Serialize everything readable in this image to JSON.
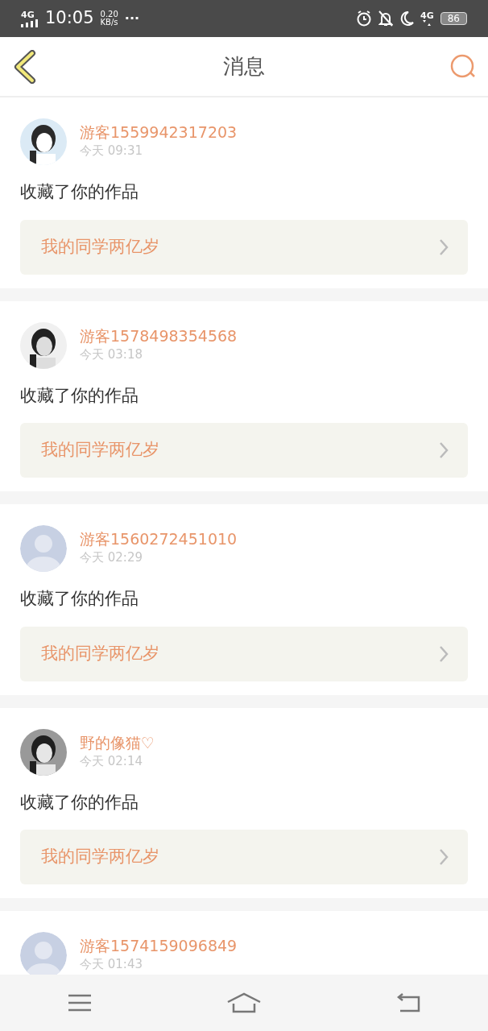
{
  "status_bar": {
    "network": "4G",
    "time": "10:05",
    "speed": "0.20",
    "speed_unit": "KB/s",
    "more": "···",
    "network_right": "4G",
    "battery": "86"
  },
  "header": {
    "title": "消息"
  },
  "messages": [
    {
      "name": "游客1559942317203",
      "time": "今天 09:31",
      "action": "收藏了你的作品",
      "work": "我的同学两亿岁"
    },
    {
      "name": "游客1578498354568",
      "time": "今天 03:18",
      "action": "收藏了你的作品",
      "work": "我的同学两亿岁"
    },
    {
      "avatar": {
        "kind": "default"
      },
      "name": "游客1560272451010",
      "time": "今天 02:29",
      "action": "收藏了你的作品",
      "work": "我的同学两亿岁"
    },
    {
      "name": "野的像猫♡",
      "time": "今天 02:14",
      "action": "收藏了你的作品",
      "work": "我的同学两亿岁"
    },
    {
      "avatar": {
        "kind": "default"
      },
      "name": "游客1574159096849",
      "time": "今天 01:43"
    }
  ]
}
